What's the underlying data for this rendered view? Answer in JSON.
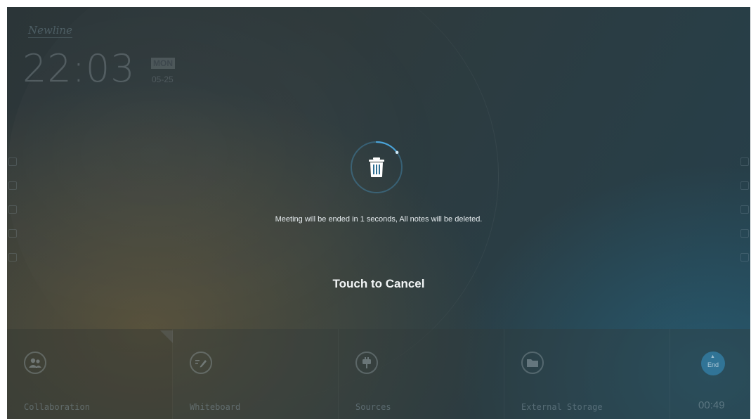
{
  "home": {
    "brand": "Newline",
    "time": "22:03",
    "day": "MON",
    "date": "05-25"
  },
  "overlay": {
    "message": "Meeting will be ended in 1 seconds, All notes will be deleted.",
    "cancel_label": "Touch to Cancel",
    "countdown_progress": 0.15,
    "accent_color": "#4aa3d8"
  },
  "dock": {
    "items": [
      {
        "label": "Collaboration",
        "icon": "people-icon"
      },
      {
        "label": "Whiteboard",
        "icon": "pen-icon"
      },
      {
        "label": "Sources",
        "icon": "plug-icon"
      },
      {
        "label": "External Storage",
        "icon": "folder-icon"
      }
    ],
    "end_label": "End",
    "timer": "00:49"
  }
}
